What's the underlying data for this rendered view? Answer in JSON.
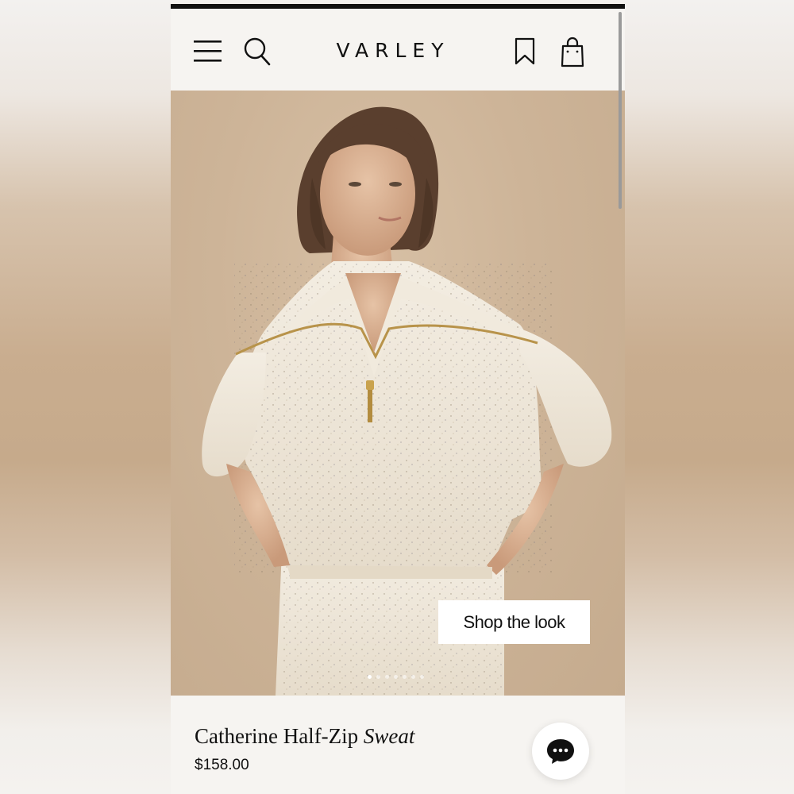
{
  "header": {
    "logo": "VARLEY",
    "menu_icon": "hamburger-menu-icon",
    "search_icon": "search-icon",
    "wishlist_icon": "bookmark-icon",
    "bag_icon": "shopping-bag-icon"
  },
  "hero": {
    "cta_label": "Shop the look",
    "carousel": {
      "total": 7,
      "active": 1
    }
  },
  "product": {
    "name_regular": "Catherine Half-Zip",
    "name_italic": "Sweat",
    "price": "$158.00"
  },
  "chat": {
    "icon": "chat-bubble-icon"
  },
  "colors": {
    "header_bg": "#f6f4f1",
    "hero_bg": "#cdb498",
    "text": "#111111"
  }
}
